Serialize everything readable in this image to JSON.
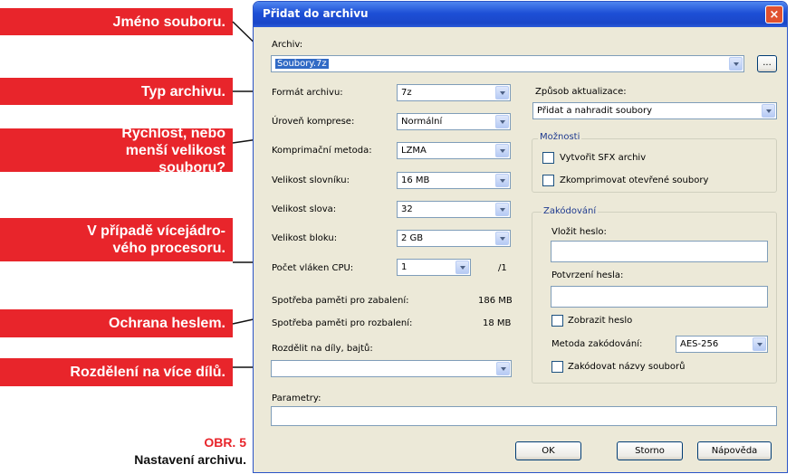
{
  "callouts": {
    "file_name": "Jméno souboru.",
    "archive_type": "Typ archivu.",
    "speed_size": "Rychlost, nebo menší velikost souboru?",
    "multicore": "V případě vícejádro-vého procesoru.",
    "password": "Ochrana heslem.",
    "split": "Rozdělení na více dílů."
  },
  "caption": {
    "figure": "OBR. 5",
    "text": "Nastavení archivu."
  },
  "dialog": {
    "title": "Přidat do archivu",
    "close": "×",
    "archive_label": "Archiv:",
    "archive_value": "Soubory.7z",
    "browse": "...",
    "format_label": "Formát archivu:",
    "format_value": "7z",
    "level_label": "Úroveň komprese:",
    "level_value": "Normální",
    "method_label": "Komprimační metoda:",
    "method_value": "LZMA",
    "dict_label": "Velikost slovníku:",
    "dict_value": "16 MB",
    "word_label": "Velikost slova:",
    "word_value": "32",
    "block_label": "Velikost bloku:",
    "block_value": "2 GB",
    "threads_label": "Počet vláken CPU:",
    "threads_value": "1",
    "threads_max": "/1",
    "mem_pack_label": "Spotřeba paměti pro zabalení:",
    "mem_pack_value": "186 MB",
    "mem_unpack_label": "Spotřeba paměti pro rozbalení:",
    "mem_unpack_value": "18 MB",
    "split_label": "Rozdělit na díly, bajtů:",
    "split_value": "",
    "params_label": "Parametry:",
    "update_label": "Způsob aktualizace:",
    "update_value": "Přidat a nahradit soubory",
    "options_group": "Možnosti",
    "sfx_label": "Vytvořit SFX archiv",
    "compress_open_label": "Zkomprimovat otevřené soubory",
    "encryption_group": "Zakódování",
    "password_label": "Vložit heslo:",
    "confirm_label": "Potvrzení hesla:",
    "show_password_label": "Zobrazit heslo",
    "enc_method_label": "Metoda zakódování:",
    "enc_method_value": "AES-256",
    "encrypt_names_label": "Zakódovat názvy souborů",
    "ok": "OK",
    "cancel": "Storno",
    "help": "Nápověda"
  },
  "colors": {
    "callout": "#e8252b",
    "titlebar": "#1d4fd6",
    "dialog_bg": "#ece9d8",
    "figure_label": "#e8252b"
  }
}
